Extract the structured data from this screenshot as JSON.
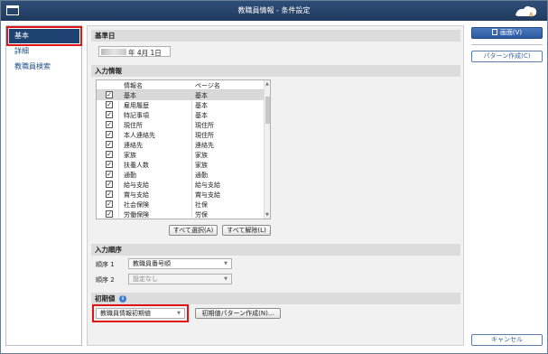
{
  "window": {
    "title": "教職員情報 - 条件設定"
  },
  "sidebar": {
    "items": [
      {
        "label": "基本",
        "active": true
      },
      {
        "label": "詳細",
        "active": false
      },
      {
        "label": "教職員検索",
        "active": false
      }
    ]
  },
  "base_date": {
    "heading": "基準日",
    "value": "年  4月  1日"
  },
  "input_info": {
    "heading": "入力情報",
    "columns": [
      "情報名",
      "ページ名"
    ],
    "rows": [
      {
        "checked": true,
        "name": "基本",
        "page": "基本"
      },
      {
        "checked": true,
        "name": "雇用履歴",
        "page": "基本"
      },
      {
        "checked": true,
        "name": "特記事項",
        "page": "基本"
      },
      {
        "checked": true,
        "name": "現住所",
        "page": "現住所"
      },
      {
        "checked": true,
        "name": "本人連絡先",
        "page": "現住所"
      },
      {
        "checked": true,
        "name": "連絡先",
        "page": "連絡先"
      },
      {
        "checked": true,
        "name": "家族",
        "page": "家族"
      },
      {
        "checked": true,
        "name": "扶養人数",
        "page": "家族"
      },
      {
        "checked": true,
        "name": "通勤",
        "page": "通勤"
      },
      {
        "checked": true,
        "name": "給与支給",
        "page": "給与支給"
      },
      {
        "checked": true,
        "name": "賞与支給",
        "page": "賞与支給"
      },
      {
        "checked": true,
        "name": "社会保険",
        "page": "社保"
      },
      {
        "checked": true,
        "name": "労働保険",
        "page": "労保"
      }
    ],
    "select_all": "すべて選択(A)",
    "deselect_all": "すべて解除(L)",
    "check_mark": "✓"
  },
  "input_order": {
    "heading": "入力順序",
    "order1_label": "順序 1",
    "order1_value": "教職員番号順",
    "order2_label": "順序 2",
    "order2_value": "設定なし"
  },
  "initial_value": {
    "heading": "初期値",
    "dropdown_value": "教職員情報初期値",
    "create_button": "初期値パターン作成(N)..."
  },
  "actions": {
    "screen_button": "画面(V)",
    "pattern_button": "パターン作成(C)",
    "cancel_button": "キャンセル"
  },
  "colors": {
    "title_bar": "#1f3a5e",
    "accent": "#2d5aa0",
    "highlight": "#e01414"
  }
}
